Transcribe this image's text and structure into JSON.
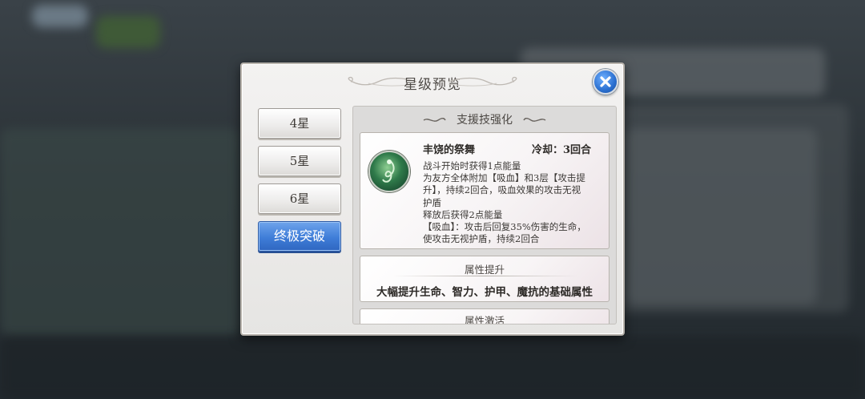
{
  "dialog": {
    "title": "星级预览"
  },
  "tabs": [
    {
      "label": "4星",
      "active": false
    },
    {
      "label": "5星",
      "active": false
    },
    {
      "label": "6星",
      "active": false
    },
    {
      "label": "终极突破",
      "active": true
    }
  ],
  "section": {
    "title": "支援技强化"
  },
  "skill": {
    "name": "丰饶的祭舞",
    "cooldown": "冷却：3回合",
    "icon": "leaf-dancer-skill-icon",
    "description_lines": [
      "战斗开始时获得1点能量",
      "为友方全体附加【吸血】和3层【攻击提",
      "升】，持续2回合，吸血效果的攻击无视",
      "护盾",
      "释放后获得2点能量",
      "【吸血】：攻击后回复35%伤害的生命，",
      "使攻击无视护盾，持续2回合"
    ]
  },
  "attribute_boost": {
    "title": "属性提升",
    "text": "大幅提升生命、智力、护甲、魔抗的基础属性"
  },
  "attribute_activate": {
    "title": "属性激活"
  },
  "colors": {
    "active_tab": "#3f7dd8",
    "close_button": "#2a6fd0",
    "dialog_bg": "#f3f2f1"
  }
}
